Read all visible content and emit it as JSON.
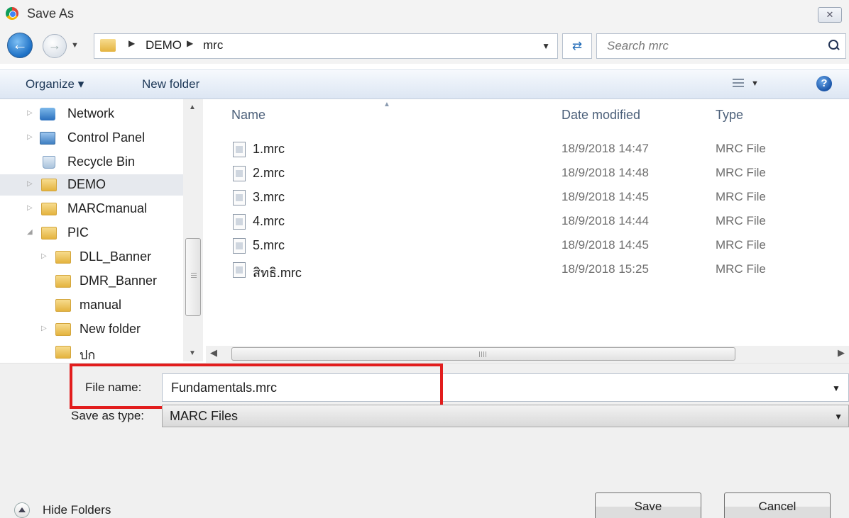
{
  "window": {
    "title": "Save As",
    "close_symbol": "✕"
  },
  "address": {
    "breadcrumbs": [
      "DEMO",
      "mrc"
    ],
    "search_placeholder": "Search mrc"
  },
  "toolbar": {
    "organize_label": "Organize ▾",
    "new_folder_label": "New folder"
  },
  "nav": {
    "items": [
      {
        "label": "Network",
        "icon": "network-icon",
        "expander": "▷"
      },
      {
        "label": "Control Panel",
        "icon": "control-panel-icon",
        "expander": "▷"
      },
      {
        "label": "Recycle Bin",
        "icon": "recycle-bin-icon",
        "expander": ""
      },
      {
        "label": "DEMO",
        "icon": "folder-icon",
        "expander": "▷",
        "selected": true
      },
      {
        "label": "MARCmanual",
        "icon": "folder-icon",
        "expander": "▷"
      },
      {
        "label": "PIC",
        "icon": "folder-icon",
        "expander": "◢"
      },
      {
        "label": "DLL_Banner",
        "icon": "folder-icon",
        "expander": "▷"
      },
      {
        "label": "DMR_Banner",
        "icon": "folder-icon",
        "expander": ""
      },
      {
        "label": "manual",
        "icon": "folder-icon",
        "expander": ""
      },
      {
        "label": "New folder",
        "icon": "folder-icon",
        "expander": "▷"
      },
      {
        "label": "ปก",
        "icon": "folder-icon",
        "expander": ""
      }
    ]
  },
  "files": {
    "columns": {
      "name": "Name",
      "date": "Date modified",
      "type": "Type"
    },
    "rows": [
      {
        "name": "1.mrc",
        "date": "18/9/2018 14:47",
        "type": "MRC File"
      },
      {
        "name": "2.mrc",
        "date": "18/9/2018 14:48",
        "type": "MRC File"
      },
      {
        "name": "3.mrc",
        "date": "18/9/2018 14:45",
        "type": "MRC File"
      },
      {
        "name": "4.mrc",
        "date": "18/9/2018 14:44",
        "type": "MRC File"
      },
      {
        "name": "5.mrc",
        "date": "18/9/2018 14:45",
        "type": "MRC File"
      },
      {
        "name": "สิทธิ.mrc",
        "date": "18/9/2018 15:25",
        "type": "MRC File"
      }
    ]
  },
  "form": {
    "file_name_label": "File name:",
    "file_name_value": "Fundamentals.mrc",
    "save_type_label": "Save as type:",
    "save_type_value": "MARC Files"
  },
  "footer": {
    "hide_folders_label": "Hide Folders",
    "save_label": "Save",
    "cancel_label": "Cancel"
  },
  "colors": {
    "highlight": "#e21d1d",
    "selection": "#e6e9ee",
    "toolbar_text": "#1e3958"
  }
}
